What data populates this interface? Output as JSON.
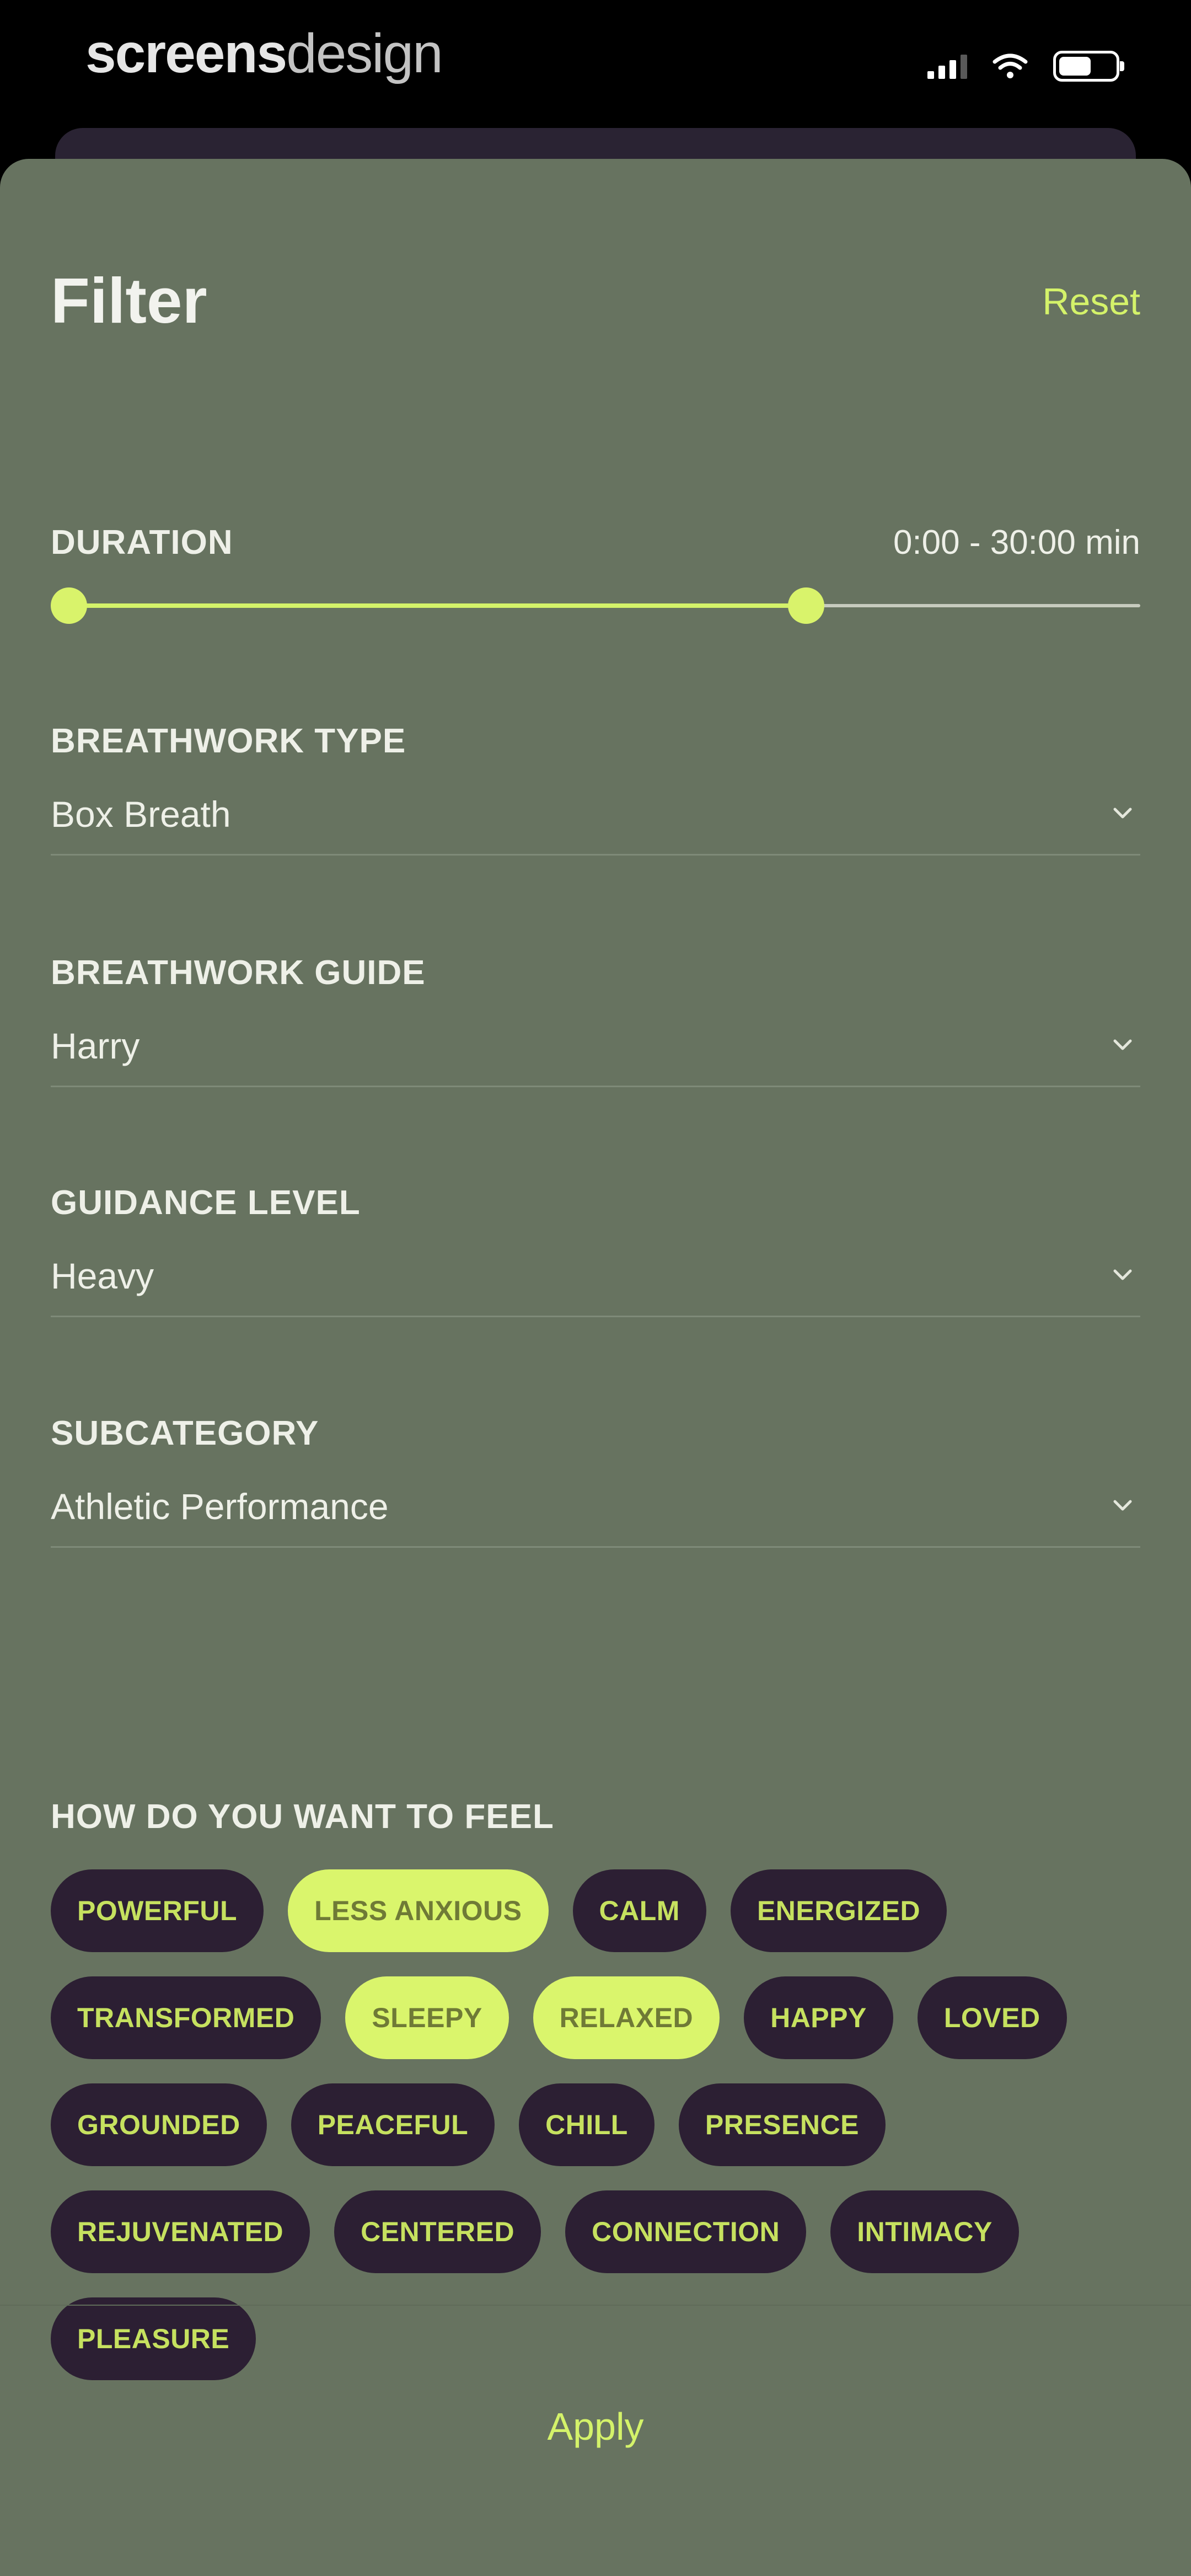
{
  "status_bar": {
    "watermark_bold": "screens",
    "watermark_light": "design",
    "icons": [
      "signal-icon",
      "wifi-icon",
      "battery-icon"
    ]
  },
  "sheet": {
    "title": "Filter",
    "reset_label": "Reset",
    "duration": {
      "label": "DURATION",
      "value_text": "0:00 - 30:00 min",
      "range_min_fraction": 0.0,
      "range_max_fraction": 0.7
    },
    "fields": [
      {
        "label": "BREATHWORK TYPE",
        "value": "Box Breath"
      },
      {
        "label": "BREATHWORK GUIDE",
        "value": "Harry"
      },
      {
        "label": "GUIDANCE LEVEL",
        "value": "Heavy"
      },
      {
        "label": "SUBCATEGORY",
        "value": "Athletic Performance"
      }
    ],
    "feel": {
      "label": "HOW DO YOU WANT TO FEEL",
      "chips": [
        {
          "label": "POWERFUL",
          "selected": false
        },
        {
          "label": "LESS ANXIOUS",
          "selected": true
        },
        {
          "label": "CALM",
          "selected": false
        },
        {
          "label": "ENERGIZED",
          "selected": false
        },
        {
          "label": "TRANSFORMED",
          "selected": false
        },
        {
          "label": "SLEEPY",
          "selected": true
        },
        {
          "label": "RELAXED",
          "selected": true
        },
        {
          "label": "HAPPY",
          "selected": false
        },
        {
          "label": "LOVED",
          "selected": false
        },
        {
          "label": "GROUNDED",
          "selected": false
        },
        {
          "label": "PEACEFUL",
          "selected": false
        },
        {
          "label": "CHILL",
          "selected": false
        },
        {
          "label": "PRESENCE",
          "selected": false
        },
        {
          "label": "REJUVENATED",
          "selected": false
        },
        {
          "label": "CENTERED",
          "selected": false
        },
        {
          "label": "CONNECTION",
          "selected": false
        },
        {
          "label": "INTIMACY",
          "selected": false
        },
        {
          "label": "PLEASURE",
          "selected": false
        }
      ]
    },
    "apply_label": "Apply"
  },
  "colors": {
    "sheet_background": "#677360",
    "accent": "#d4f26a",
    "chip_dark": "#2c1f33",
    "status_bar": "#000000"
  }
}
